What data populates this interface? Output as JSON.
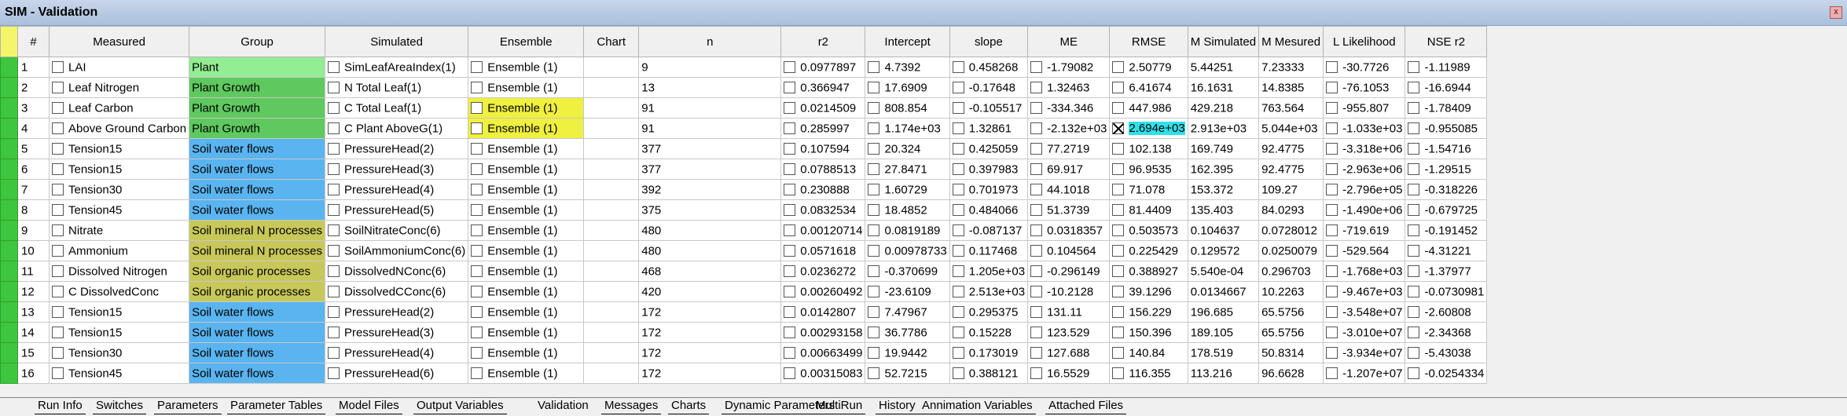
{
  "window": {
    "title": "SIM - Validation",
    "close_glyph": "x"
  },
  "columns": [
    "#",
    "Measured",
    "Group",
    "Simulated",
    "Ensemble",
    "Chart",
    "n",
    "r2",
    "Intercept",
    "slope",
    "ME",
    "RMSE",
    "M Simulated",
    "M Mesured",
    "L Likelihood",
    "NSE r2"
  ],
  "rows": [
    {
      "idx": "1",
      "measured": "LAI",
      "group": "Plant",
      "group_style": "g-plant",
      "simulated": "SimLeafAreaIndex(1)",
      "ensemble": "Ensemble (1)",
      "chart": "",
      "n": "9",
      "r2": "0.0977897",
      "intercept": "4.7392",
      "slope": "0.458268",
      "me": "-1.79082",
      "rmse": "2.50779",
      "msim": "5.44251",
      "mmes": "7.23333",
      "ll": "-30.7726",
      "nse": "-1.11989"
    },
    {
      "idx": "2",
      "measured": "Leaf Nitrogen",
      "group": "Plant Growth",
      "group_style": "g-growth",
      "simulated": "N Total Leaf(1)",
      "ensemble": "Ensemble (1)",
      "chart": "",
      "n": "13",
      "r2": "0.366947",
      "intercept": "17.6909",
      "slope": "-0.17648",
      "me": "1.32463",
      "rmse": "6.41674",
      "msim": "16.1631",
      "mmes": "14.8385",
      "ll": "-76.1053",
      "nse": "-16.6944"
    },
    {
      "idx": "3",
      "measured": "Leaf Carbon",
      "group": "Plant Growth",
      "group_style": "g-growth",
      "simulated": "C Total Leaf(1)",
      "ensemble": "Ensemble (1)",
      "ens_hl": true,
      "chart": "",
      "n": "91",
      "r2": "0.0214509",
      "intercept": "808.854",
      "slope": "-0.105517",
      "me": "-334.346",
      "rmse": "447.986",
      "msim": "429.218",
      "mmes": "763.564",
      "ll": "-955.807",
      "nse": "-1.78409"
    },
    {
      "idx": "4",
      "measured": "Above Ground Carbon",
      "group": "Plant Growth",
      "group_style": "g-growth",
      "simulated": "C Plant AboveG(1)",
      "ensemble": "Ensemble (1)",
      "ens_hl": true,
      "chart": "",
      "n": "91",
      "r2": "0.285997",
      "intercept": "1.174e+03",
      "slope": "1.32861",
      "me": "-2.132e+03",
      "rmse": "2.694e+03",
      "rmse_sel": true,
      "msim": "2.913e+03",
      "mmes": "5.044e+03",
      "ll": "-1.033e+03",
      "nse": "-0.955085"
    },
    {
      "idx": "5",
      "measured": "Tension15",
      "group": "Soil water flows",
      "group_style": "g-water",
      "simulated": "PressureHead(2)",
      "ensemble": "Ensemble (1)",
      "chart": "",
      "n": "377",
      "r2": "0.107594",
      "intercept": "20.324",
      "slope": "0.425059",
      "me": "77.2719",
      "rmse": "102.138",
      "msim": "169.749",
      "mmes": "92.4775",
      "ll": "-3.318e+06",
      "nse": "-1.54716"
    },
    {
      "idx": "6",
      "measured": "Tension15",
      "group": "Soil water flows",
      "group_style": "g-water",
      "simulated": "PressureHead(3)",
      "ensemble": "Ensemble (1)",
      "chart": "",
      "n": "377",
      "r2": "0.0788513",
      "intercept": "27.8471",
      "slope": "0.397983",
      "me": "69.917",
      "rmse": "96.9535",
      "msim": "162.395",
      "mmes": "92.4775",
      "ll": "-2.963e+06",
      "nse": "-1.29515"
    },
    {
      "idx": "7",
      "measured": "Tension30",
      "group": "Soil water flows",
      "group_style": "g-water",
      "simulated": "PressureHead(4)",
      "ensemble": "Ensemble (1)",
      "chart": "",
      "n": "392",
      "r2": "0.230888",
      "intercept": "1.60729",
      "slope": "0.701973",
      "me": "44.1018",
      "rmse": "71.078",
      "msim": "153.372",
      "mmes": "109.27",
      "ll": "-2.796e+05",
      "nse": "-0.318226"
    },
    {
      "idx": "8",
      "measured": "Tension45",
      "group": "Soil water flows",
      "group_style": "g-water",
      "simulated": "PressureHead(5)",
      "ensemble": "Ensemble (1)",
      "chart": "",
      "n": "375",
      "r2": "0.0832534",
      "intercept": "18.4852",
      "slope": "0.484066",
      "me": "51.3739",
      "rmse": "81.4409",
      "msim": "135.403",
      "mmes": "84.0293",
      "ll": "-1.490e+06",
      "nse": "-0.679725"
    },
    {
      "idx": "9",
      "measured": "Nitrate",
      "group": "Soil mineral N processes",
      "group_style": "g-mineral",
      "simulated": "SoilNitrateConc(6)",
      "ensemble": "Ensemble (1)",
      "chart": "",
      "n": "480",
      "r2": "0.00120714",
      "intercept": "0.0819189",
      "slope": "-0.087137",
      "me": "0.0318357",
      "rmse": "0.503573",
      "msim": "0.104637",
      "mmes": "0.0728012",
      "ll": "-719.619",
      "nse": "-0.191452"
    },
    {
      "idx": "10",
      "measured": "Ammonium",
      "group": "Soil mineral N processes",
      "group_style": "g-mineral",
      "simulated": "SoilAmmoniumConc(6)",
      "ensemble": "Ensemble (1)",
      "chart": "",
      "n": "480",
      "r2": "0.0571618",
      "intercept": "0.00978733",
      "slope": "0.117468",
      "me": "0.104564",
      "rmse": "0.225429",
      "msim": "0.129572",
      "mmes": "0.0250079",
      "ll": "-529.564",
      "nse": "-4.31221"
    },
    {
      "idx": "11",
      "measured": "Dissolved Nitrogen",
      "group": "Soil organic processes",
      "group_style": "g-organic",
      "simulated": "DissolvedNConc(6)",
      "ensemble": "Ensemble (1)",
      "chart": "",
      "n": "468",
      "r2": "0.0236272",
      "intercept": "-0.370699",
      "slope": "1.205e+03",
      "me": "-0.296149",
      "rmse": "0.388927",
      "msim": "5.540e-04",
      "mmes": "0.296703",
      "ll": "-1.768e+03",
      "nse": "-1.37977"
    },
    {
      "idx": "12",
      "measured": "C DissolvedConc",
      "group": "Soil organic processes",
      "group_style": "g-organic",
      "simulated": "DissolvedCConc(6)",
      "ensemble": "Ensemble (1)",
      "chart": "",
      "n": "420",
      "r2": "0.00260492",
      "intercept": "-23.6109",
      "slope": "2.513e+03",
      "me": "-10.2128",
      "rmse": "39.1296",
      "msim": "0.0134667",
      "mmes": "10.2263",
      "ll": "-9.467e+03",
      "nse": "-0.0730981"
    },
    {
      "idx": "13",
      "measured": "Tension15",
      "group": "Soil water flows",
      "group_style": "g-water",
      "simulated": "PressureHead(2)",
      "ensemble": "Ensemble (1)",
      "chart": "",
      "n": "172",
      "r2": "0.0142807",
      "intercept": "7.47967",
      "slope": "0.295375",
      "me": "131.11",
      "rmse": "156.229",
      "msim": "196.685",
      "mmes": "65.5756",
      "ll": "-3.548e+07",
      "nse": "-2.60808"
    },
    {
      "idx": "14",
      "measured": "Tension15",
      "group": "Soil water flows",
      "group_style": "g-water",
      "simulated": "PressureHead(3)",
      "ensemble": "Ensemble (1)",
      "chart": "",
      "n": "172",
      "r2": "0.00293158",
      "intercept": "36.7786",
      "slope": "0.15228",
      "me": "123.529",
      "rmse": "150.396",
      "msim": "189.105",
      "mmes": "65.5756",
      "ll": "-3.010e+07",
      "nse": "-2.34368"
    },
    {
      "idx": "15",
      "measured": "Tension30",
      "group": "Soil water flows",
      "group_style": "g-water",
      "simulated": "PressureHead(4)",
      "ensemble": "Ensemble (1)",
      "chart": "",
      "n": "172",
      "r2": "0.00663499",
      "intercept": "19.9442",
      "slope": "0.173019",
      "me": "127.688",
      "rmse": "140.84",
      "msim": "178.519",
      "mmes": "50.8314",
      "ll": "-3.934e+07",
      "nse": "-5.43038"
    },
    {
      "idx": "16",
      "measured": "Tension45",
      "group": "Soil water flows",
      "group_style": "g-water",
      "simulated": "PressureHead(6)",
      "ensemble": "Ensemble (1)",
      "chart": "",
      "n": "172",
      "r2": "0.00315083",
      "intercept": "52.7215",
      "slope": "0.388121",
      "me": "16.5529",
      "rmse": "116.355",
      "msim": "113.216",
      "mmes": "96.6628",
      "ll": "-1.207e+07",
      "nse": "-0.0254334"
    }
  ],
  "tabs": [
    "Run Info",
    "Switches",
    "Parameters",
    "Parameter Tables",
    "Model Files",
    "Output Variables",
    "Validation",
    "Messages",
    "Charts",
    "Dynamic Parameters",
    "MultiRun",
    "History",
    "Annimation Variables",
    "Attached Files"
  ],
  "active_tab": "Validation"
}
